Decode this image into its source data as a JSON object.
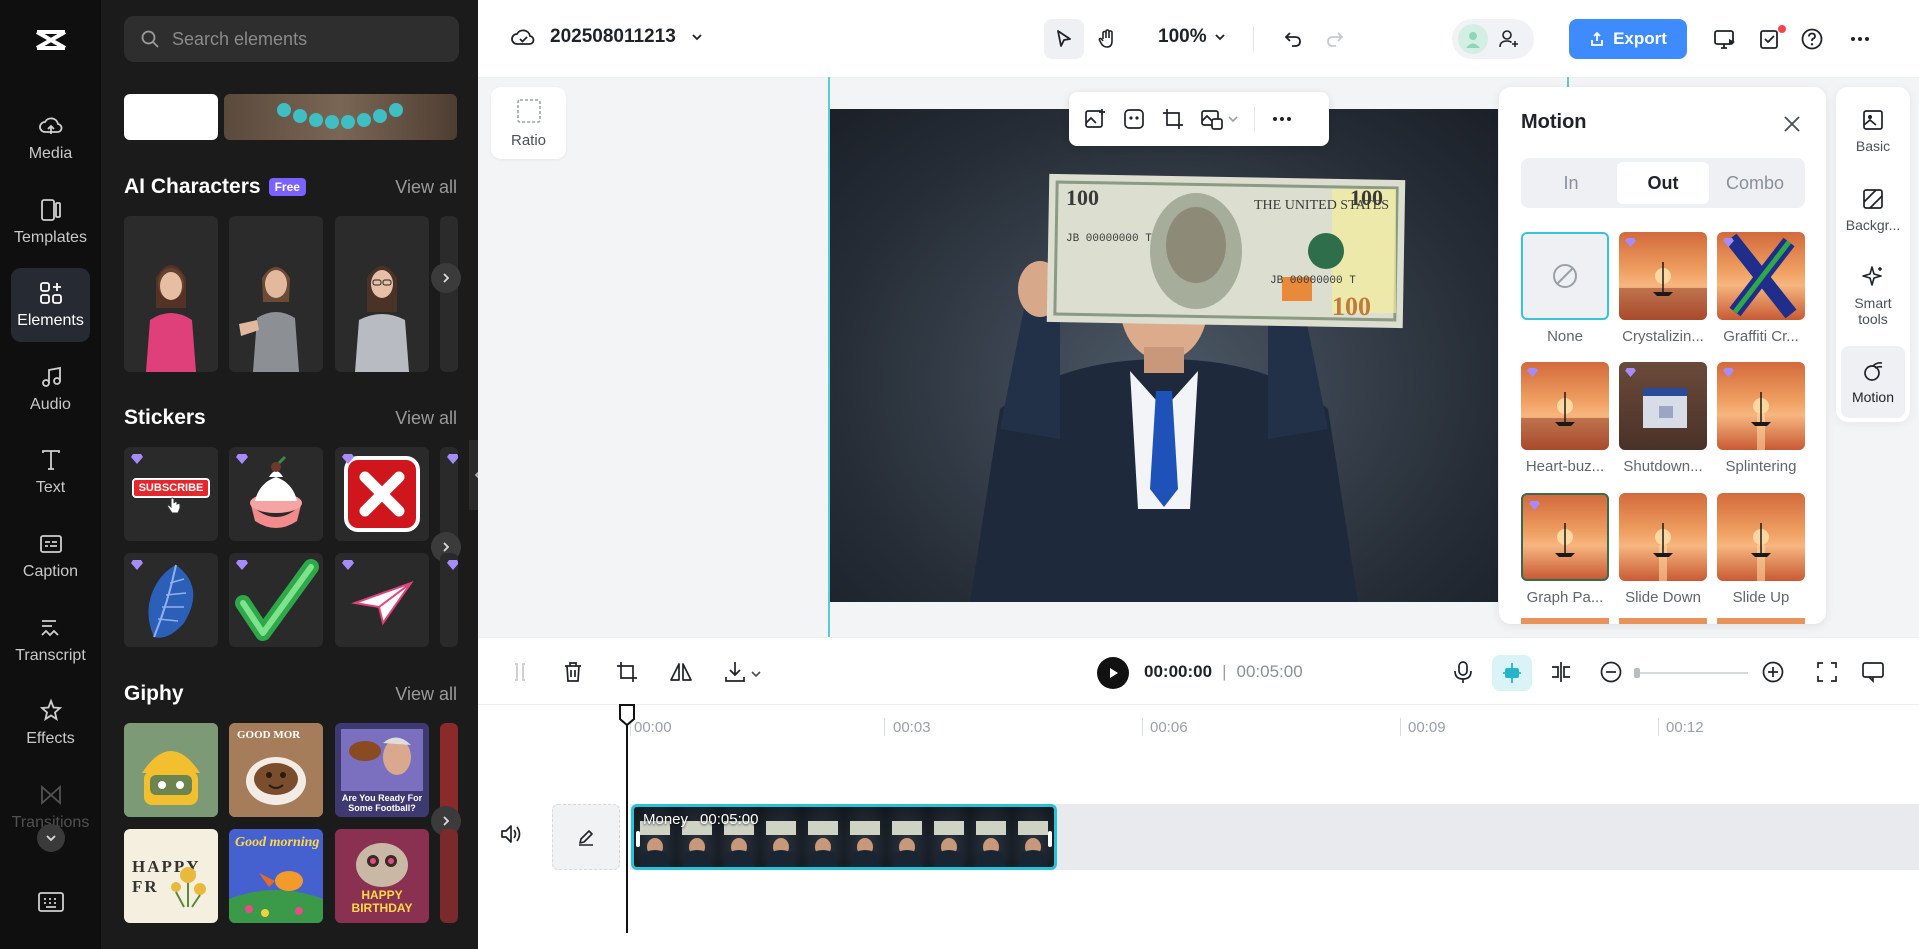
{
  "rail": {
    "items": [
      {
        "label": "Media",
        "icon": "cloud-upload-icon"
      },
      {
        "label": "Templates",
        "icon": "templates-icon"
      },
      {
        "label": "Elements",
        "icon": "elements-icon"
      },
      {
        "label": "Audio",
        "icon": "music-note-icon"
      },
      {
        "label": "Text",
        "icon": "text-icon"
      },
      {
        "label": "Caption",
        "icon": "caption-icon"
      },
      {
        "label": "Transcript",
        "icon": "transcript-icon"
      },
      {
        "label": "Effects",
        "icon": "effects-icon"
      },
      {
        "label": "Transitions",
        "icon": "transitions-icon"
      }
    ],
    "active": "Elements"
  },
  "panel": {
    "search_placeholder": "Search elements",
    "sections": {
      "ai_characters": {
        "title": "AI Characters",
        "badge": "Free",
        "view_all": "View all"
      },
      "stickers": {
        "title": "Stickers",
        "view_all": "View all",
        "subscribe_text": "SUBSCRIBE"
      },
      "giphy": {
        "title": "Giphy",
        "view_all": "View all",
        "gif_captions": [
          "GOOD MOR",
          "Are You Ready For Some Football?",
          "HAPPY FR",
          "Good morning",
          "HAPPY BIRTHDAY"
        ]
      }
    }
  },
  "topbar": {
    "project_name": "202508011213",
    "zoom": "100%",
    "export_label": "Export"
  },
  "canvas": {
    "ratio_label": "Ratio"
  },
  "motion": {
    "title": "Motion",
    "tabs": [
      "In",
      "Out",
      "Combo"
    ],
    "active_tab": "Out",
    "animations": [
      "None",
      "Crystalizin...",
      "Graffiti Cr...",
      "Heart-buz...",
      "Shutdown...",
      "Splintering",
      "Graph Pa...",
      "Slide Down",
      "Slide Up"
    ],
    "selected": "None"
  },
  "side_tabs": [
    {
      "label": "Basic"
    },
    {
      "label": "Backgr..."
    },
    {
      "label": "Smart tools"
    },
    {
      "label": "Motion"
    }
  ],
  "timeline": {
    "current_time": "00:00:00",
    "separator": "|",
    "total_time": "00:05:00",
    "ticks": [
      "00:00",
      "00:03",
      "00:06",
      "00:09",
      "00:12"
    ],
    "clip": {
      "name": "Money",
      "duration": "00:05:00"
    }
  },
  "colors": {
    "accent": "#3d8bfd",
    "selection": "#27c2d8",
    "rail_bg": "#0f0f0f",
    "panel_bg": "#1b1b1b"
  }
}
